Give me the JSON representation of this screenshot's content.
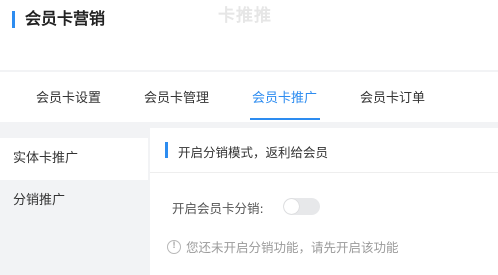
{
  "header": {
    "title": "会员卡营销",
    "watermark": "卡推推"
  },
  "tabs": [
    {
      "label": "会员卡设置",
      "active": false
    },
    {
      "label": "会员卡管理",
      "active": false
    },
    {
      "label": "会员卡推广",
      "active": true
    },
    {
      "label": "会员卡订单",
      "active": false
    }
  ],
  "sidebar": {
    "items": [
      {
        "label": "实体卡推广",
        "active": true
      },
      {
        "label": "分销推广",
        "active": false
      }
    ]
  },
  "content": {
    "section_title": "开启分销模式，返利给会员",
    "toggle_label": "开启会员卡分销:",
    "toggle_on": false,
    "notice_text": "您还未开启分销功能，请先开启该功能"
  },
  "colors": {
    "accent": "#2d8cf0",
    "background": "#f2f3f5"
  }
}
